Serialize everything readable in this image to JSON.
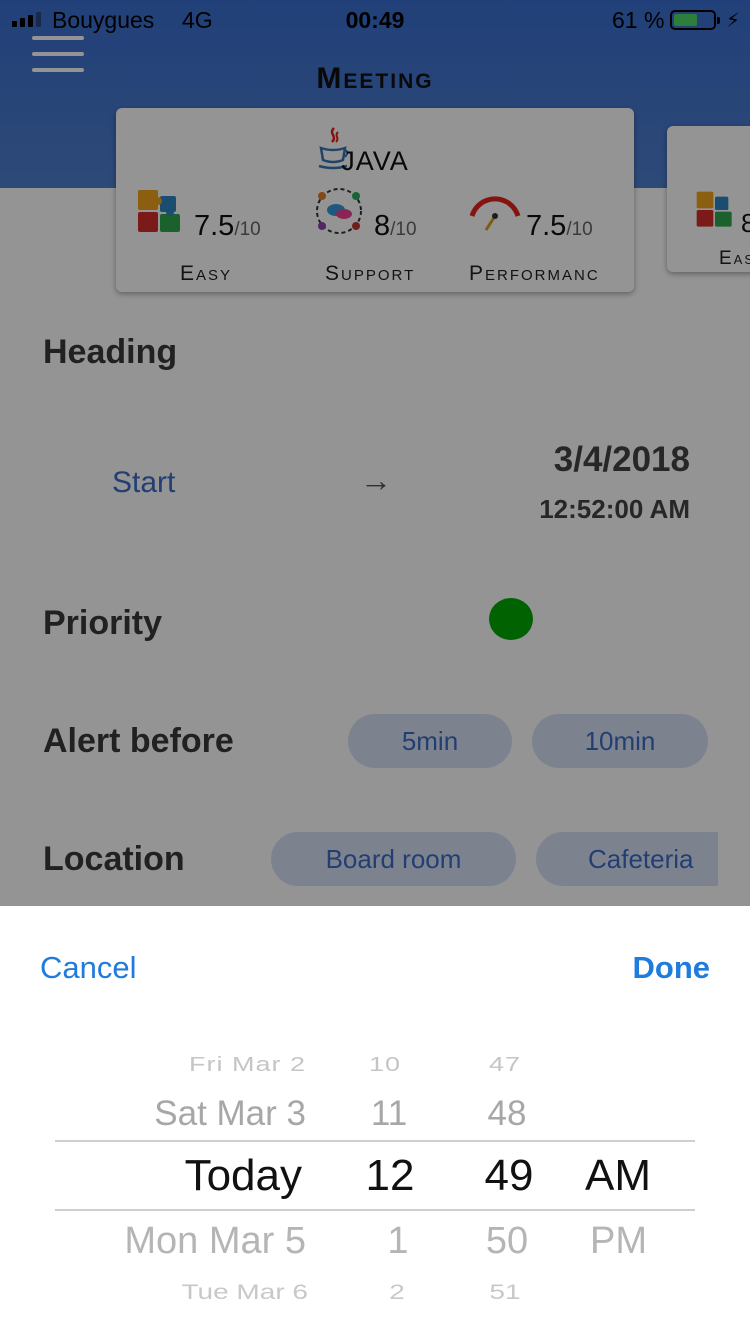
{
  "status_bar": {
    "carrier": "Bouygues",
    "network": "4G",
    "time": "00:49",
    "battery_percent": "61 %",
    "battery_level": 0.61
  },
  "nav": {
    "title": "Meeting",
    "menu_icon": "hamburger-icon"
  },
  "rating_card": {
    "title": "JAVA",
    "icon": "java-cup-icon",
    "metrics": [
      {
        "icon": "puzzle-icon",
        "score": "7.5",
        "out_of": "/10",
        "label": "Easy"
      },
      {
        "icon": "support-team-icon",
        "score": "8",
        "out_of": "/10",
        "label": "Support"
      },
      {
        "icon": "gauge-icon",
        "score": "7.5",
        "out_of": "/10",
        "label": "Performanc"
      }
    ]
  },
  "next_card": {
    "score": "8",
    "label": "Eas"
  },
  "form": {
    "heading_label": "Heading",
    "start_label": "Start",
    "start_date": "3/4/2018",
    "start_time": "12:52:00 AM",
    "priority_label": "Priority",
    "priority_color": "#00aa00",
    "alert_label": "Alert before",
    "alert_options": [
      "5min",
      "10min"
    ],
    "location_label": "Location",
    "location_options": [
      "Board room",
      "Cafeteria"
    ]
  },
  "picker": {
    "cancel": "Cancel",
    "done": "Done",
    "day_column": [
      "Fri Mar 2",
      "Sat Mar 3",
      "Today",
      "Mon Mar 5",
      "Tue Mar 6"
    ],
    "hour_column": [
      "10",
      "11",
      "12",
      "1",
      "2"
    ],
    "minute_column": [
      "47",
      "48",
      "49",
      "50",
      "51"
    ],
    "ampm_column": [
      "",
      "",
      "AM",
      "PM",
      ""
    ]
  },
  "colors": {
    "header": "#3a6fd0",
    "accent": "#1f7bdc",
    "link": "#3d6cc7"
  }
}
